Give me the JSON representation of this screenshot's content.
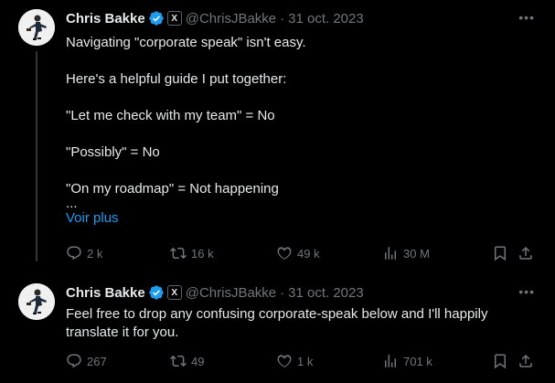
{
  "tweets": [
    {
      "author": "Chris Bakke",
      "handle": "@ChrisJBakke",
      "separator": "·",
      "date": "31 oct. 2023",
      "affiliate_badge": "X",
      "more_label": "•••",
      "lines": [
        "Navigating \"corporate speak\" isn't easy.",
        "",
        "Here's a helpful guide I put together:",
        "",
        "\"Let me check with my team\" = No",
        "",
        "\"Possibly\" = No",
        "",
        "\"On my roadmap\" = Not happening",
        "..."
      ],
      "show_more": "Voir plus",
      "replies": "2 k",
      "retweets": "16 k",
      "likes": "49 k",
      "views": "30 M"
    },
    {
      "author": "Chris Bakke",
      "handle": "@ChrisJBakke",
      "separator": "·",
      "date": "31 oct. 2023",
      "affiliate_badge": "X",
      "more_label": "•••",
      "lines": [
        "Feel free to drop any confusing corporate-speak below and I'll happily translate it for you."
      ],
      "replies": "267",
      "retweets": "49",
      "likes": "1 k",
      "views": "701 k"
    }
  ],
  "colors": {
    "accent": "#1d9bf0",
    "muted": "#71767b",
    "text": "#e7e9ea",
    "background": "#000000"
  },
  "icons": [
    "reply-icon",
    "retweet-icon",
    "like-icon",
    "views-icon",
    "bookmark-icon",
    "share-icon",
    "verified-icon"
  ]
}
